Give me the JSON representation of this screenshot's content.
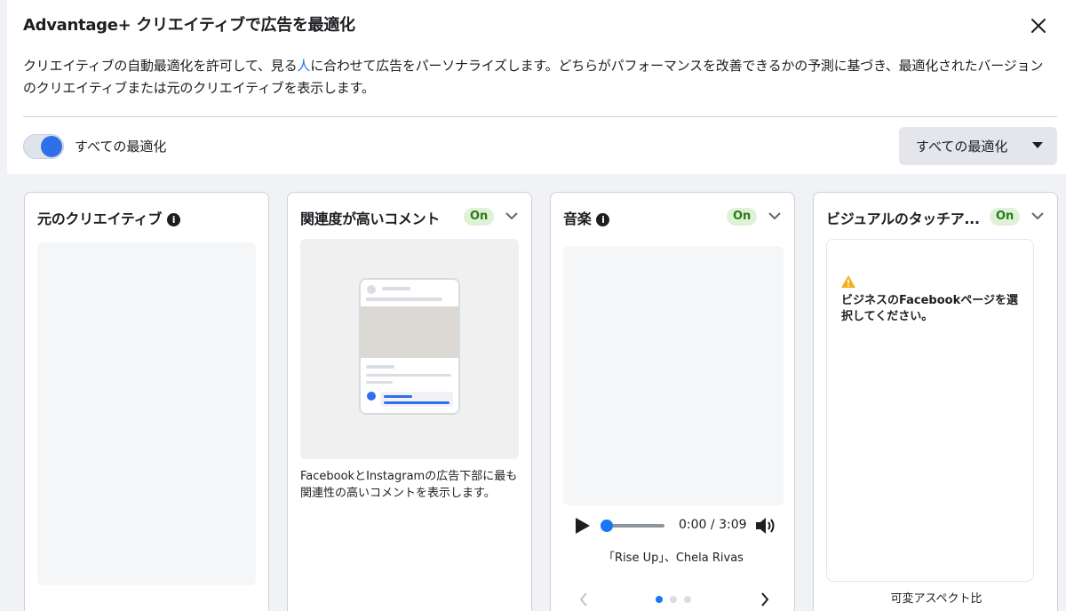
{
  "dialog": {
    "title": "Advantage+ クリエイティブで広告を最適化",
    "close_icon": "close-icon",
    "description_before": "クリエイティブの自動最適化を許可して、見る",
    "description_highlight": "人",
    "description_after": "に合わせて広告をパーソナライズします。どちらがパフォーマンスを改善できるかの予測に基づき、最適化されたバージョンのクリエイティブまたは元のクリエイティブを表示します。"
  },
  "toggle": {
    "label": "すべての最適化",
    "state": "on"
  },
  "dropdown": {
    "selected": "すべての最適化"
  },
  "cards": [
    {
      "title": "元のクリエイティブ",
      "has_info_icon": true
    },
    {
      "title": "関連度が高いコメント",
      "badge": "On",
      "description": "FacebookとInstagramの広告下部に最も関連性の高いコメントを表示します。"
    },
    {
      "title": "音楽",
      "has_info_icon": true,
      "badge": "On",
      "player": {
        "current_time": "0:00",
        "separator": "/",
        "duration": "3:09",
        "progress": 0
      },
      "song": "「Rise Up」、Chela Rivas",
      "carousel_page": 1,
      "carousel_total": 3
    },
    {
      "title": "ビジュアルのタッチア...",
      "badge": "On",
      "warning": "ビジネスのFacebookページを選択してください。",
      "footer": "可変アスペクト比"
    }
  ],
  "colors": {
    "accent": "#1877f2",
    "badge_bg": "#dff2d8",
    "badge_text": "#2b7a19",
    "toggle_knob": "#2f6fea",
    "warning": "#f2b01e"
  }
}
